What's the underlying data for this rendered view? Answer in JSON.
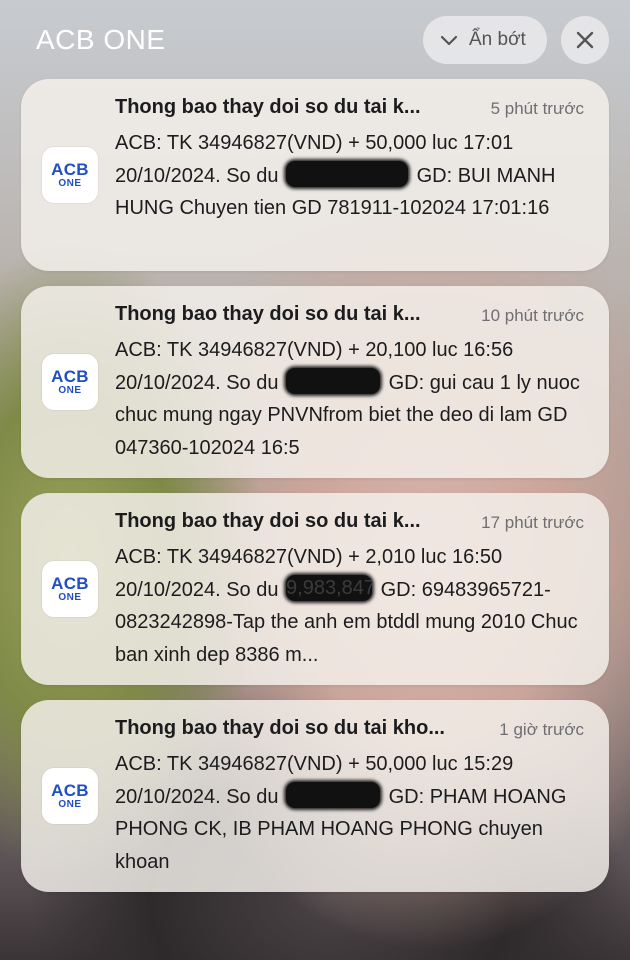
{
  "group": {
    "title": "ACB ONE",
    "collapse_label": "Ẩn bớt",
    "collapse_icon": "chevron-down-icon",
    "close_icon": "close-icon"
  },
  "app_icon": {
    "line1": "ACB",
    "line2": "ONE"
  },
  "notifications": [
    {
      "title": "Thong bao thay doi so du tai k...",
      "time": "5 phút trước",
      "body_before": "ACB: TK 34946827(VND) + 50,000 luc 17:01 20/10/2024. So du",
      "redacted_peek": "",
      "body_after": "GD: BUI MANH HUNG Chuyen tien GD 781911-102024 17:01:16"
    },
    {
      "title": "Thong bao thay doi so du tai k...",
      "time": "10 phút trước",
      "body_before": "ACB: TK 34946827(VND) + 20,100 luc 16:56 20/10/2024. So du",
      "redacted_peek": "",
      "body_after": "GD: gui cau 1 ly nuoc chuc mung ngay PNVNfrom biet the deo di lam GD 047360-102024 16:5"
    },
    {
      "title": "Thong bao thay doi so du tai k...",
      "time": "17 phút trước",
      "body_before": "ACB: TK 34946827(VND) + 2,010 luc 16:50 20/10/2024. So du",
      "redacted_peek": "9,983,847",
      "body_after": "GD: 69483965721-0823242898-Tap the anh em btddl mung 2010 Chuc ban xinh dep 8386 m..."
    },
    {
      "title": "Thong bao thay doi so du tai kho...",
      "time": "1 giờ trước",
      "body_before": "ACB: TK 34946827(VND) + 50,000 luc 15:29 20/10/2024. So du",
      "redacted_peek": "",
      "body_after": "GD: PHAM HOANG PHONG CK, IB PHAM HOANG PHONG chuyen khoan"
    }
  ]
}
